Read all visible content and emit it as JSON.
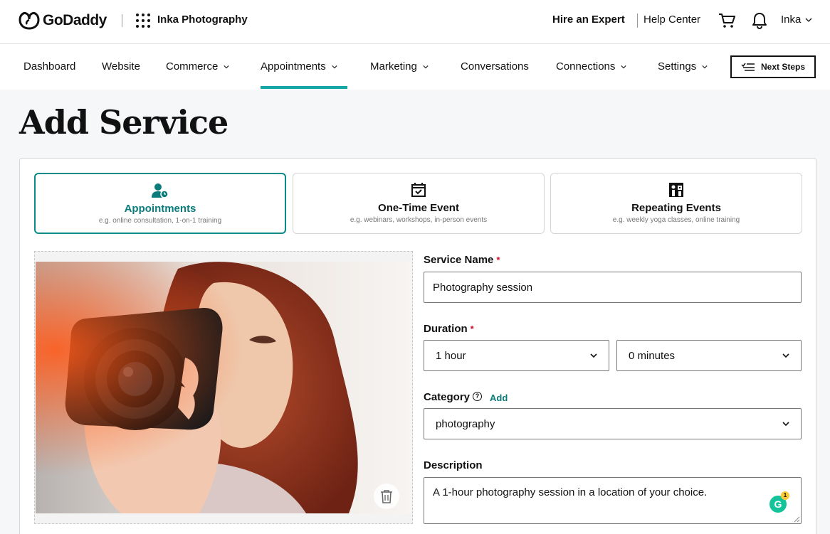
{
  "header": {
    "brand": "GoDaddy",
    "site_name": "Inka Photography",
    "hire_expert": "Hire an Expert",
    "help_center": "Help Center",
    "user_name": "Inka"
  },
  "nav": {
    "items": [
      {
        "label": "Dashboard"
      },
      {
        "label": "Website"
      },
      {
        "label": "Commerce"
      },
      {
        "label": "Appointments"
      },
      {
        "label": "Marketing"
      },
      {
        "label": "Conversations"
      },
      {
        "label": "Connections"
      },
      {
        "label": "Settings"
      }
    ],
    "active": "Appointments",
    "next_steps": "Next Steps"
  },
  "page": {
    "title": "Add Service"
  },
  "service_types": [
    {
      "title": "Appointments",
      "subtitle": "e.g. online consultation, 1-on-1 training",
      "icon": "person-clock-icon",
      "selected": true
    },
    {
      "title": "One-Time Event",
      "subtitle": "e.g. webinars, workshops, in-person events",
      "icon": "calendar-check-icon",
      "selected": false
    },
    {
      "title": "Repeating Events",
      "subtitle": "e.g. weekly yoga classes, online training",
      "icon": "repeat-people-icon",
      "selected": false
    }
  ],
  "form": {
    "service_name": {
      "label": "Service Name",
      "required": "*",
      "value": "Photography session"
    },
    "duration": {
      "label": "Duration",
      "required": "*",
      "hours": "1 hour",
      "minutes": "0 minutes"
    },
    "category": {
      "label": "Category",
      "help": "?",
      "add": "Add",
      "value": "photography"
    },
    "description": {
      "label": "Description",
      "value": "A 1-hour photography session in a location of your choice."
    }
  },
  "grammarly": {
    "letter": "G",
    "count": "1"
  },
  "colors": {
    "accent": "#0b7b7b",
    "required": "#c8102e"
  }
}
